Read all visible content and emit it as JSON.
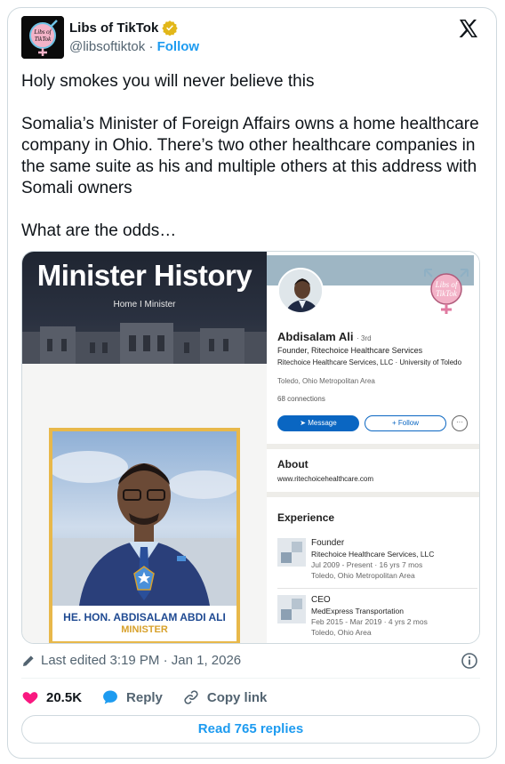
{
  "account": {
    "display_name": "Libs of TikTok",
    "handle": "@libsoftiktok",
    "separator": "·",
    "follow_label": "Follow",
    "avatar_text": "Libs of TikTok"
  },
  "tweet": {
    "paragraphs": [
      "Holy smokes you will never believe this",
      "Somalia’s Minister of Foreign Affairs owns a home healthcare company in Ohio. There’s two other healthcare companies in the same suite as his and multiple others at this address with Somali owners",
      "What are the odds…"
    ]
  },
  "media": {
    "left": {
      "title": "Minister History",
      "breadcrumb": "Home  I  Minister",
      "caption_name": "HE. HON. ABDISALAM ABDI ALI",
      "caption_role": "MINISTER"
    },
    "right": {
      "name": "Abdisalam Ali",
      "degree": "· 3rd",
      "headline": "Founder, Ritechoice Healthcare Services",
      "company_line": "Ritechoice Healthcare Services, LLC · University of Toledo",
      "location": "Toledo, Ohio Metropolitan Area",
      "connections": "68 connections",
      "message_label": "Message",
      "follow_label": "+ Follow",
      "more_label": "···",
      "about_heading": "About",
      "about_url": "www.ritechoicehealthcare.com",
      "experience_heading": "Experience",
      "badge_text": "Libs of TikTok",
      "experience": [
        {
          "title": "Founder",
          "company": "Ritechoice Healthcare Services, LLC",
          "dates": "Jul 2009 - Present · 16 yrs 7 mos",
          "location": "Toledo, Ohio Metropolitan Area"
        },
        {
          "title": "CEO",
          "company": "MedExpress Transportation",
          "dates": "Feb 2015 - Mar 2019 · 4 yrs 2 mos",
          "location": "Toledo, Ohio Area"
        }
      ]
    }
  },
  "meta": {
    "edited": "Last edited 3:19 PM · Jan 1, 2026"
  },
  "actions": {
    "likes": "20.5K",
    "reply_label": "Reply",
    "copy_label": "Copy link"
  },
  "read_replies_label": "Read 765 replies",
  "colors": {
    "accent": "#1d9bf0",
    "like": "#f91880",
    "linkedin": "#0a66c2",
    "caption_blue": "#1f4a92",
    "caption_gold": "#d8a12b"
  },
  "icons": [
    "verified-icon",
    "x-logo-icon",
    "pencil-icon",
    "info-icon",
    "heart-icon",
    "reply-icon",
    "link-icon"
  ]
}
